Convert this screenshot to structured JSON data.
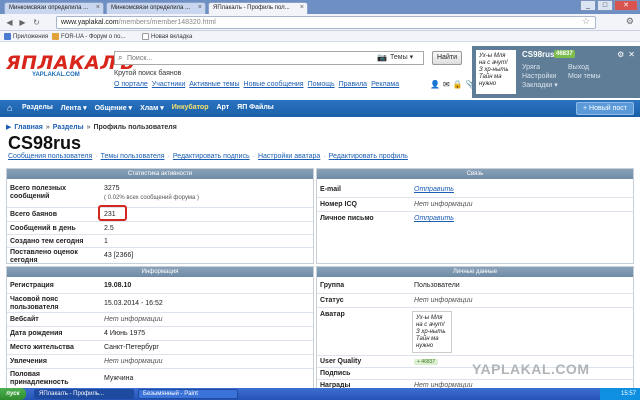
{
  "browser": {
    "tabs": [
      {
        "label": "Минкомсвязи определила ...",
        "active": false
      },
      {
        "label": "Минкомсвязи определила ...",
        "active": false
      },
      {
        "label": "ЯПлакалъ - Профиль пол...",
        "active": true
      }
    ],
    "url_domain": "www.yaplakal.com",
    "url_path": "/members/member148320.html",
    "bookmarks": [
      "Приложения",
      "FOR-UA - Форум о по...",
      "Новая вкладка"
    ],
    "win_buttons": {
      "minimize": "_",
      "maximize": "□",
      "close": "✕"
    }
  },
  "site": {
    "logo": "ЯПЛАКАЛЪ",
    "logo_sub": "YAPLAKAL.COM",
    "search_placeholder": "Поиск...",
    "search_scope": "Темы ▾",
    "find_button": "Найти",
    "tagline": "Крутой поиск баянов",
    "top_links": [
      "О портале",
      "Участники",
      "Активные темы",
      "Новые сообщения",
      "Помощь",
      "Правила",
      "Реклама"
    ],
    "user": {
      "name": "CS98rus",
      "rating": "46837",
      "links_col1": [
        "Уряга",
        "Настройки",
        "Закладки ▾"
      ],
      "links_col2": [
        "Выход",
        "Мои темы"
      ]
    },
    "avatar_text": "Ух-ы Мля на с ачут! З хр-ныть Тайн ма нужно"
  },
  "nav": {
    "items": [
      "Разделы",
      "Лента ▾",
      "Общение ▾",
      "Хлам ▾",
      "Инкубатор",
      "Арт",
      "ЯП Файлы"
    ],
    "new_post": "+ Новый пост"
  },
  "breadcrumb": [
    "Главная",
    "Разделы",
    "Профиль пользователя"
  ],
  "profile": {
    "title": "CS98rus",
    "sublinks": [
      "Сообщения пользователя",
      "Темы пользователя",
      "Редактировать подпись",
      "Настройки аватара",
      "Редактировать профиль"
    ]
  },
  "stats": {
    "header": "Статистика активности",
    "rows": [
      {
        "k": "Всего полезных сообщений",
        "v": "3275",
        "note": "( 0.02% всех сообщений форума )"
      },
      {
        "k": "Всего баянов",
        "v": "231"
      },
      {
        "k": "Сообщений в день",
        "v": "2.5"
      },
      {
        "k": "Создано тем сегодня",
        "v": "1"
      },
      {
        "k": "Поставлено оценок сегодня",
        "v": "43 [2366]"
      }
    ]
  },
  "contact": {
    "header": "Связь",
    "rows": [
      {
        "k": "E-mail",
        "v": "Отправить",
        "type": "send"
      },
      {
        "k": "Номер ICQ",
        "v": "Нет информации",
        "type": "na"
      },
      {
        "k": "Личное письмо",
        "v": "Отправить",
        "type": "send"
      }
    ]
  },
  "info": {
    "header": "Информация",
    "rows": [
      {
        "k": "Регистрация",
        "v": "19.08.10",
        "bold": true
      },
      {
        "k": "Часовой пояс пользователя",
        "v": "15.03.2014 - 16:52"
      },
      {
        "k": "Вебсайт",
        "v": "Нет информации",
        "type": "na"
      },
      {
        "k": "Дата рождения",
        "v": "4 Июнь 1975"
      },
      {
        "k": "Место жительства",
        "v": "Санкт-Петербург"
      },
      {
        "k": "Увлечения",
        "v": "Нет информации",
        "type": "na"
      },
      {
        "k": "Половая принадлежность",
        "v": "Мужчина"
      }
    ]
  },
  "personal": {
    "header": "Личные данные",
    "rows": [
      {
        "k": "Группа",
        "v": "Пользователи"
      },
      {
        "k": "Статус",
        "v": "Нет информации",
        "type": "na"
      },
      {
        "k": "Аватар",
        "v": ""
      },
      {
        "k": "User Quality",
        "v": "+ 46837"
      },
      {
        "k": "Подпись",
        "v": ""
      },
      {
        "k": "Награды",
        "v": "Нет информации",
        "type": "na"
      }
    ]
  },
  "watermark": "YAPLAKAL.COM",
  "taskbar": {
    "start": "пуск",
    "items": [
      "ЯПлакалъ - Профиль...",
      "Безымянный - Paint"
    ],
    "clock": "15:57"
  },
  "colors": {
    "accent": "#1a5ea8",
    "logo": "#d9261c",
    "highlight_box": "#d3261f"
  }
}
